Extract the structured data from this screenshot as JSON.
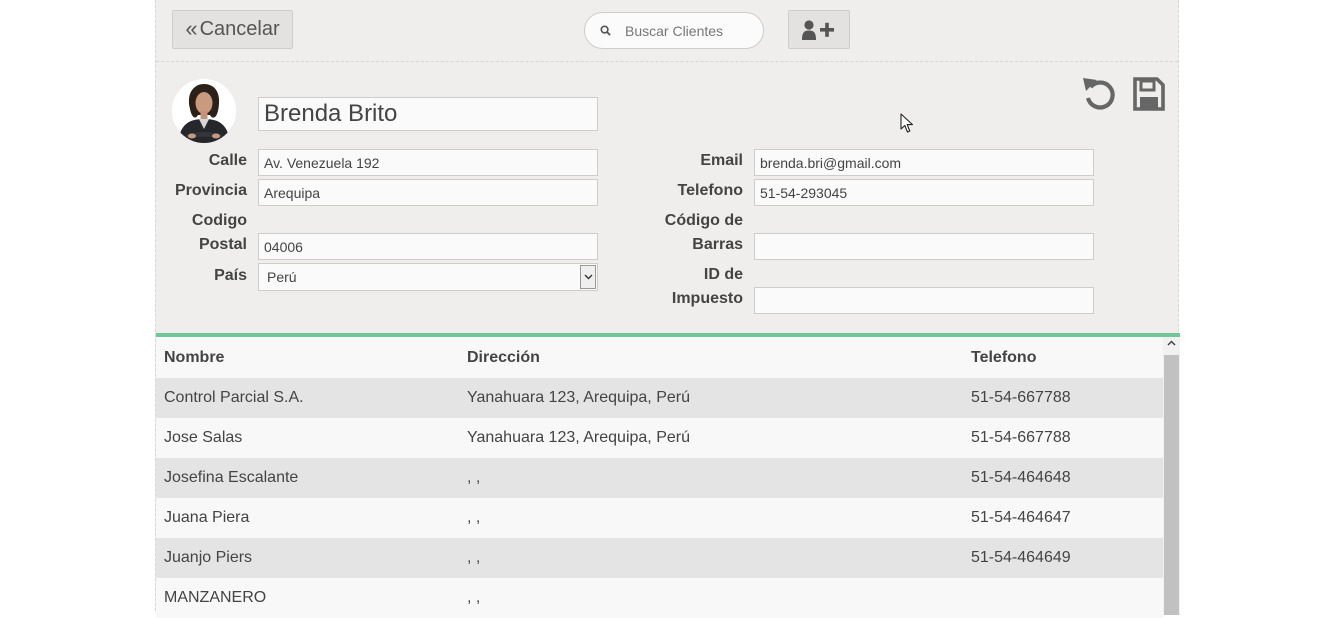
{
  "toolbar": {
    "cancel_label": "Cancelar",
    "search_placeholder": "Buscar Clientes"
  },
  "customer": {
    "name": "Brenda Brito",
    "fields_left": [
      {
        "label": "Calle",
        "value": "Av. Venezuela 192"
      },
      {
        "label": "Provincia",
        "value": "Arequipa"
      },
      {
        "label": "Codigo Postal",
        "value": "04006"
      },
      {
        "label": "País",
        "value": "Perú"
      }
    ],
    "fields_right": [
      {
        "label": "Email",
        "value": "brenda.bri@gmail.com"
      },
      {
        "label": "Telefono",
        "value": "51-54-293045"
      },
      {
        "label": "Código de Barras",
        "value": ""
      },
      {
        "label": "ID de Impuesto",
        "value": ""
      }
    ],
    "label_codigo_1": "Codigo",
    "label_codigo_2": "Postal",
    "label_barras_1": "Código de",
    "label_barras_2": "Barras",
    "label_id_1": "ID de",
    "label_id_2": "Impuesto"
  },
  "table": {
    "headers": [
      "Nombre",
      "Dirección",
      "Telefono"
    ],
    "rows": [
      {
        "nombre": "Control Parcial S.A.",
        "direccion": "Yanahuara 123, Arequipa, Perú",
        "telefono": "51-54-667788"
      },
      {
        "nombre": "Jose Salas",
        "direccion": "Yanahuara 123, Arequipa, Perú",
        "telefono": "51-54-667788"
      },
      {
        "nombre": "Josefina Escalante",
        "direccion": ", ,",
        "telefono": "51-54-464648"
      },
      {
        "nombre": "Juana Piera",
        "direccion": ", ,",
        "telefono": "51-54-464647"
      },
      {
        "nombre": "Juanjo Piers",
        "direccion": ", ,",
        "telefono": "51-54-464649"
      },
      {
        "nombre": "MANZANERO",
        "direccion": ", ,",
        "telefono": ""
      }
    ]
  },
  "colors": {
    "accent": "#6fc79b",
    "panel": "#efeeec",
    "row_alt": "#e4e4e4"
  }
}
